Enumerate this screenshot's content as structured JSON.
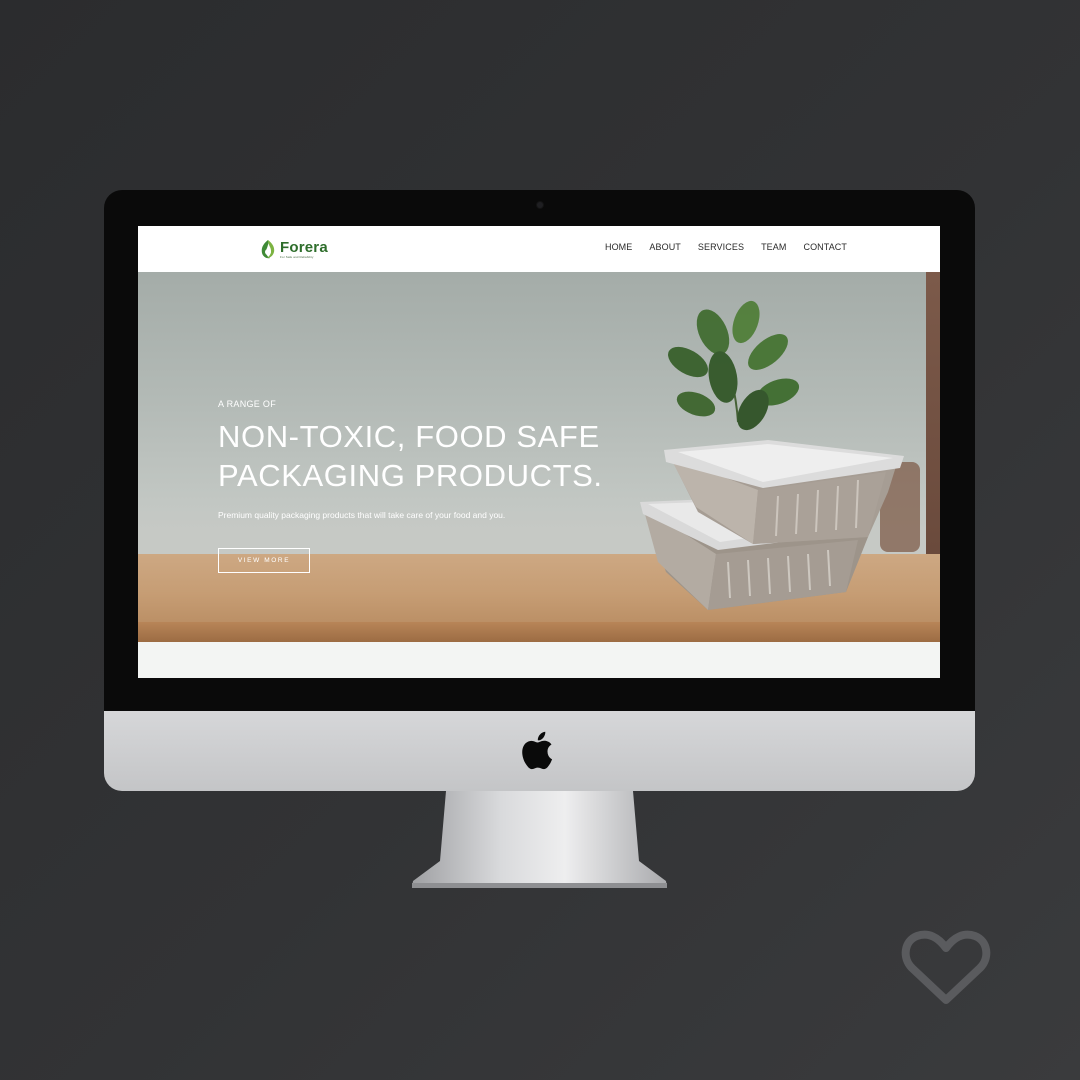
{
  "brand": {
    "name": "Forera",
    "tagline": "For Safe and Reliability",
    "color": "#2f6e2c"
  },
  "nav": {
    "items": [
      {
        "label": "HOME"
      },
      {
        "label": "ABOUT"
      },
      {
        "label": "SERVICES"
      },
      {
        "label": "TEAM"
      },
      {
        "label": "CONTACT"
      }
    ]
  },
  "hero": {
    "eyebrow": "A RANGE OF",
    "title_line1": "NON-TOXIC, FOOD SAFE",
    "title_line2": "PACKAGING PRODUCTS.",
    "subtitle": "Premium quality packaging products that will take care of your food and you.",
    "cta_label": "VIEW MORE"
  },
  "icons": {
    "apple": "apple-logo-icon",
    "heart": "heart-icon"
  },
  "colors": {
    "background": "#2f3032",
    "bezel": "#0a0a0a",
    "chin": "#cfd0d2",
    "text_on_hero": "#ffffff"
  }
}
